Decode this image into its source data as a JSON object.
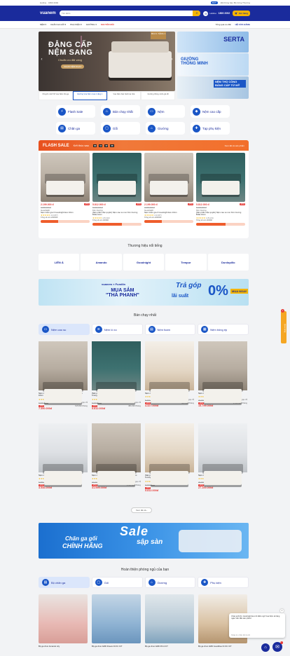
{
  "topbar": {
    "left_text": "Hotline · 1800 2092",
    "right_text": "Đã thông báo Bộ Công Thương",
    "badge": "BCT"
  },
  "header": {
    "logo": "vuanem",
    "search_placeholder": "Tìm kiếm",
    "hotline_label": "Hotline:",
    "hotline_number": "1800 2092",
    "cart_label": "Giỏ hàng"
  },
  "nav": {
    "items": [
      "NỆM ▾",
      "CHĂN GA GỐI ▾",
      "PHỤ KIỆN ▾",
      "GIƯỜNG ▾"
    ],
    "hot": "KHUYẾN MÃI",
    "right_items": [
      "Tổng quà ưu đãi",
      "HỆ CỬA HÀNG"
    ]
  },
  "hero": {
    "title_line1": "ĐẲNG CẤP",
    "title_line2": "NỆM SANG",
    "subtitle": "Chuẩn ưu đãi vàng",
    "cta": "CHỌN NỆM NGAY",
    "badge": "MUA 1 TẶNG 1",
    "tabs": [
      "Khuyến mãi Tết Vua Nệm thả ga",
      "Giường Vua Nệm mua 1 tặng 1",
      "Vua Nệm bảo hành tại nhà",
      "Giường thông minh giá tốt"
    ],
    "side1": "SERTA",
    "side2_line1": "GIƯỜNG",
    "side2_line2": "THÔNG MINH",
    "side3": "NỆM THỦ CÔNG BẢNG CẤP TỪ MỸ"
  },
  "categories": [
    {
      "label": "Flash Sale",
      "icon": "flash-icon"
    },
    {
      "label": "Bán chạy nhất",
      "icon": "fire-icon"
    },
    {
      "label": "Nệm",
      "icon": "mattress-icon"
    },
    {
      "label": "Nệm cao cấp",
      "icon": "premium-icon"
    },
    {
      "label": "Chăn ga",
      "icon": "blanket-icon"
    },
    {
      "label": "Gối",
      "icon": "pillow-icon"
    },
    {
      "label": "Giường",
      "icon": "bed-icon"
    },
    {
      "label": "Tạp phụ kiện",
      "icon": "accessory-icon"
    }
  ],
  "flash": {
    "title": "FLASH SALE",
    "ends_label": "Kết thúc sau",
    "timer": [
      "00",
      "11",
      "47",
      "26"
    ],
    "view_all": "Xem tất cả sản phẩm",
    "items": [
      {
        "price": "2.199.000 đ",
        "old": "3.990.000 đ",
        "disc": "-45%",
        "brand": "Goodnight",
        "name": "Nệm foam gia 3 Goodnight Evo 10cm",
        "rating": "4.9",
        "reviews": "(87)",
        "sold": "Tổng số còn 200/300",
        "progress": 0.35
      },
      {
        "price": "5.812.000 đ",
        "old": "8.303.000 đ",
        "disc": "-30%",
        "brand": "Kim Cương",
        "name": "[Sản phẩm độc quyền] Nệm cao su non Kim Cương Brilla 10cm",
        "rating": "4.8",
        "reviews": "(32)",
        "sold": "Tổng số còn 30/300",
        "progress": 0.6
      },
      {
        "price": "2.199.000 đ",
        "old": "3.990.000 đ",
        "disc": "-45%",
        "brand": "Goodnight",
        "name": "Nệm foam gia 3 Goodnight Evo 10cm",
        "rating": "4.9",
        "reviews": "(87)",
        "sold": "Tổng số còn 200/300",
        "progress": 0.35
      },
      {
        "price": "5.812.000 đ",
        "old": "8.303.000 đ",
        "disc": "-30%",
        "brand": "Kim Cương",
        "name": "[Sản phẩm độc quyền] Nệm cao su non Kim Cương Brilla 10cm",
        "rating": "4.8",
        "reviews": "(24)",
        "sold": "Tổng số còn 30/300",
        "progress": 0.6
      }
    ]
  },
  "brands": {
    "title": "Thương hiệu nổi tiếng",
    "items": [
      "LIÊN Á",
      "Amando",
      "Goodnight",
      "Tempur",
      "Dunlopillo"
    ]
  },
  "promo": {
    "top": "vuanem × Fundiin",
    "main_line1": "MUA SẮM",
    "main_line2": "\"THẢ PHANH\"",
    "tagline": "Trả góp",
    "zero": "0%",
    "interest": "lãi suất",
    "cta": "MUA NGAY"
  },
  "best": {
    "title": "Bán chạy nhất",
    "tabs": [
      "Nệm cao su",
      "Nệm lò xo",
      "Nệm foam",
      "Nệm bông ép"
    ],
    "row1": [
      {
        "name": "Nệm cao su Kim Cương Victory 10 Barral Cao cấp 10cm",
        "rating": "4.9",
        "reviews": "(275)",
        "old": "8.990.000đ",
        "disc": "-18%",
        "price": "7.390.000đ",
        "inst_label": "Trả góp chỉ",
        "inst": "615.833₫/tháng"
      },
      {
        "name": "[Sản phẩm độc quyền] Nệm cao su Kim Cương Crung…",
        "rating": "4.8",
        "reviews": "(80)",
        "old": "8.303.000đ",
        "disc": "-30%",
        "price": "5.812.000đ",
        "inst_label": "Trả góp chỉ",
        "inst": "484.333₫/tháng"
      },
      {
        "name": "Nệm cao su Kim Cương Happy Gold",
        "rating": "4.8",
        "reviews": "(54)",
        "old": "5.410.000đ",
        "disc": "-20%",
        "price": "4.327.000đ",
        "inst_label": "Trả góp chỉ",
        "inst": "360.583₫/tháng"
      },
      {
        "name": "Nệm cao su Barral Lotus cũng Di Thông cao 5ấ",
        "rating": "4.8",
        "reviews": "(51)",
        "old": "22.464.000đ",
        "disc": "-30%",
        "price": "15.799.000đ",
        "inst_label": "Trả góp chỉ",
        "inst": "1.316.583₫/tháng"
      }
    ],
    "row2": [
      {
        "name": "Nệm cao su Liên Á Classic",
        "rating": "4.9",
        "reviews": "(89)",
        "old": "5.065.000đ",
        "disc": "-30%",
        "price": "3.546.000đ",
        "inst_label": "",
        "inst": ""
      },
      {
        "name": "Nệm cao su thiên nhiên Barral Legacy Tương 25cm",
        "rating": "4.9",
        "reviews": "(53)",
        "old": "43.312.000đ",
        "disc": "-25%",
        "price": "31.999.000đ",
        "inst_label": "Trả góp chỉ",
        "inst": "2.666.583₫/tháng"
      },
      {
        "name": "[Sản phẩm độc quyền] Nệm cao su tổng hợp Kim Cương…",
        "rating": "4.8",
        "reviews": "(40)",
        "old": "8.303.000đ",
        "disc": "-30%",
        "price": "5.812.000đ",
        "inst_label": "",
        "inst": ""
      },
      {
        "name": "Nệm cao su Dunlopillo Markt Relax",
        "rating": "4.9",
        "reviews": "(22)",
        "old": "39.000.000đ",
        "disc": "-30%",
        "price": "27.100.000đ",
        "inst_label": "",
        "inst": ""
      }
    ],
    "more": "Xem tất cả ›"
  },
  "sale_banner": {
    "line1": "Chăn ga gối",
    "line2": "CHÍNH HÃNG",
    "sale": "Sale",
    "sub": "sập sàn"
  },
  "bedroom": {
    "title": "Hoàn thiện phòng ngủ của bạn",
    "tabs": [
      "Bộ chăn ga",
      "Gối",
      "Giường",
      "Phụ kiện"
    ],
    "items": [
      {
        "name": "Bộ ga chun Amando Lily"
      },
      {
        "name": "Bộ ga chun AMD Dream Di KC ICT"
      },
      {
        "name": "Bộ ga chun AMD Print ICT"
      },
      {
        "name": "Bộ ga chun AMD Goodblue Di OC ICT"
      }
    ]
  },
  "chat": {
    "text": "Chào anh/chị, Goodnight Evo ốc Điều ngờ Vua Nệm sẽ tặng ngàn Vấn đầu sản phẩm!",
    "reply": "Nhập tin nhắn để trả lời"
  },
  "gift": {
    "label": "Quà tặng",
    "count": "1"
  },
  "fab": {
    "count": "2"
  }
}
